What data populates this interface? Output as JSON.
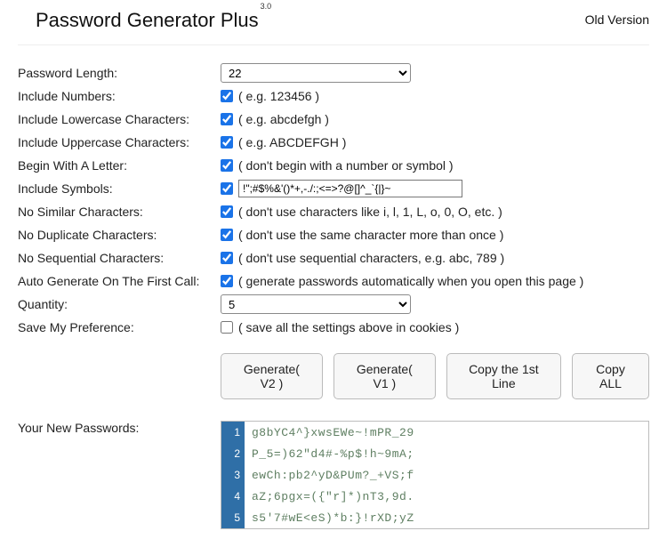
{
  "header": {
    "title": "Password Generator Plus",
    "version_sup": "3.0",
    "old_version": "Old Version"
  },
  "form": {
    "length": {
      "label": "Password Length:",
      "value": "22"
    },
    "numbers": {
      "label": "Include Numbers:",
      "checked": true,
      "hint": "( e.g. 123456 )"
    },
    "lowercase": {
      "label": "Include Lowercase Characters:",
      "checked": true,
      "hint": "( e.g. abcdefgh )"
    },
    "uppercase": {
      "label": "Include Uppercase Characters:",
      "checked": true,
      "hint": "( e.g. ABCDEFGH )"
    },
    "begin_letter": {
      "label": "Begin With A Letter:",
      "checked": true,
      "hint": "( don't begin with a number or symbol )"
    },
    "symbols": {
      "label": "Include Symbols:",
      "checked": true,
      "value": "!\";#$%&'()*+,-./:;<=>?@[]^_`{|}~"
    },
    "no_similar": {
      "label": "No Similar Characters:",
      "checked": true,
      "hint": "( don't use characters like i, l, 1, L, o, 0, O, etc. )"
    },
    "no_duplicate": {
      "label": "No Duplicate Characters:",
      "checked": true,
      "hint": "( don't use the same character more than once )"
    },
    "no_sequential": {
      "label": "No Sequential Characters:",
      "checked": true,
      "hint": "( don't use sequential characters, e.g. abc, 789 )"
    },
    "auto_gen": {
      "label": "Auto Generate On The First Call:",
      "checked": true,
      "hint": "( generate passwords automatically when you open this page )"
    },
    "quantity": {
      "label": "Quantity:",
      "value": "5"
    },
    "save_pref": {
      "label": "Save My Preference:",
      "checked": false,
      "hint": "( save all the settings above in cookies )"
    }
  },
  "buttons": {
    "gen_v2": "Generate( V2 )",
    "gen_v1": "Generate( V1 )",
    "copy_first": "Copy the 1st Line",
    "copy_all": "Copy ALL"
  },
  "results": {
    "label": "Your New Passwords:",
    "passwords": [
      "g8bYC4^}xwsEWe~!mPR_29",
      "P_5=)62\"d4#-%p$!h~9mA;",
      "ewCh:pb2^yD&PUm?_+VS;f",
      "aZ;6pgx=({\"r]*)nT3,9d.",
      "s5'7#wE<eS)*b:}!rXD;yZ"
    ]
  }
}
